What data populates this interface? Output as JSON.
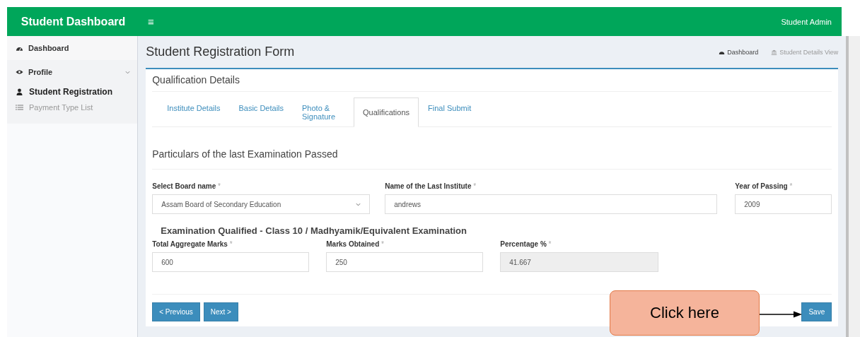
{
  "header": {
    "brand": "Student Dashboard",
    "menu_icon": "≡",
    "user": "Student Admin"
  },
  "sidebar": {
    "items": [
      {
        "label": "Dashboard",
        "kind": "link"
      },
      {
        "label": "Profile",
        "kind": "group",
        "expanded": true,
        "children": [
          {
            "label": "Student Registration",
            "active": true
          },
          {
            "label": "Payment Type List",
            "active": false
          }
        ]
      }
    ]
  },
  "page": {
    "title": "Student Registration Form",
    "breadcrumb": [
      {
        "label": "Dashboard"
      },
      {
        "label": "Student Details View"
      }
    ]
  },
  "panel": {
    "title": "Qualification Details",
    "tabs": [
      {
        "label": "Institute Details",
        "selected": false
      },
      {
        "label": "Basic Details",
        "selected": false
      },
      {
        "label": "Photo & Signature",
        "selected": false
      },
      {
        "label": "Qualifications",
        "selected": true
      },
      {
        "label": "Final Submit",
        "selected": false
      }
    ],
    "section_title": "Particulars of the last Examination Passed",
    "row_1": [
      {
        "label": "Select Board name",
        "required_mark": "*",
        "kind": "select",
        "value": "Assam Board of Secondary Education",
        "disabled": false
      },
      {
        "label": "Name of the Last Institute",
        "required_mark": "*",
        "kind": "input",
        "value": "andrews",
        "disabled": false
      },
      {
        "label": "Year of Passing",
        "required_mark": "*",
        "kind": "input",
        "value": "2009",
        "disabled": false
      }
    ],
    "exam_heading": "Examination Qualified - Class 10 / Madhyamik/Equivalent Examination",
    "row_2": [
      {
        "label": "Total Aggregate Marks",
        "required_mark": "*",
        "value": "600",
        "disabled": false
      },
      {
        "label": "Marks Obtained",
        "required_mark": "*",
        "value": "250",
        "disabled": false
      },
      {
        "label": "Percentage %",
        "required_mark": "*",
        "value": "41.667",
        "disabled": true
      }
    ],
    "buttons": {
      "previous": "< Previous",
      "next": "Next >",
      "save": "Save"
    }
  },
  "callout": {
    "text": "Click here"
  }
}
